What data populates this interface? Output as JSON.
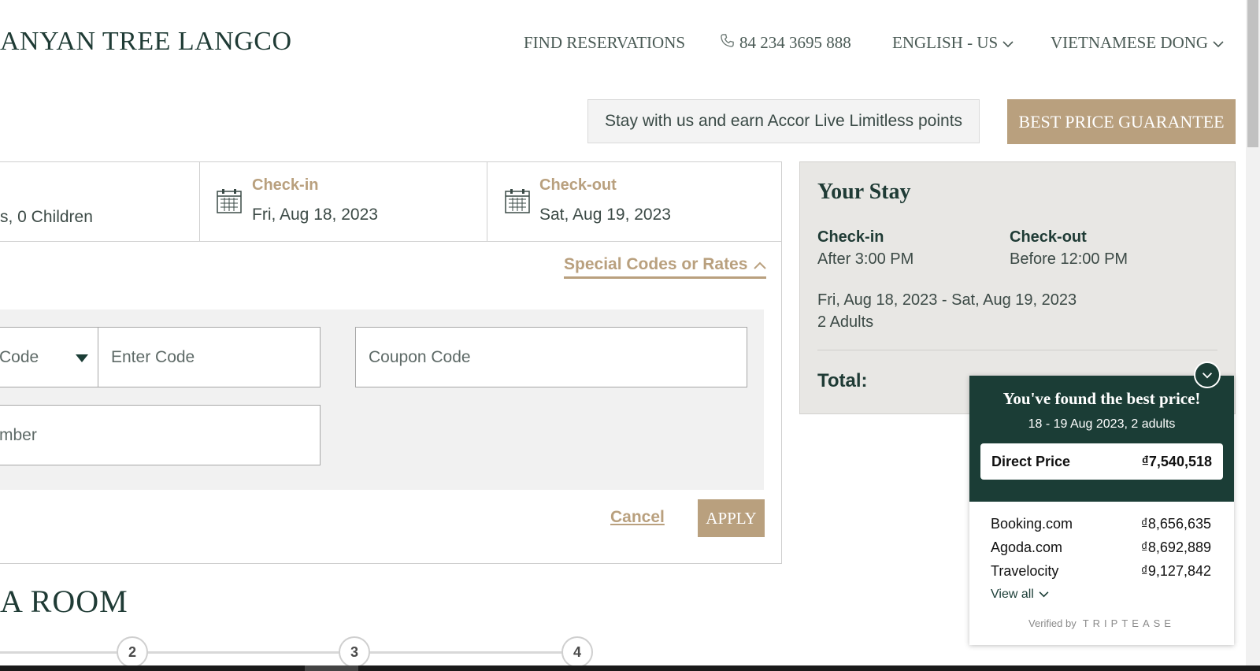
{
  "header": {
    "brand": "ANYAN TREE LANGCO",
    "nav": {
      "find_reservations": "FIND RESERVATIONS",
      "phone": "84 234 3695 888",
      "language": "ENGLISH - US",
      "currency": "VIETNAMESE DONG"
    }
  },
  "promo": {
    "accor_text": "Stay with us and earn Accor Live Limitless points",
    "best_price": "BEST PRICE GUARANTEE"
  },
  "booking": {
    "guests": "s, 0 Children",
    "checkin_label": "Check-in",
    "checkin_value": "Fri, Aug 18, 2023",
    "checkout_label": "Check-out",
    "checkout_value": "Sat, Aug 19, 2023",
    "special_codes": "Special Codes or Rates",
    "code_type": "Code",
    "enter_code_placeholder": "Enter Code",
    "coupon_placeholder": "Coupon Code",
    "member_placeholder": "mber",
    "cancel": "Cancel",
    "apply": "APPLY"
  },
  "section_title": "A ROOM",
  "steps": [
    "2",
    "3",
    "4"
  ],
  "your_stay": {
    "title": "Your Stay",
    "checkin_label": "Check-in",
    "checkin_value": "After 3:00 PM",
    "checkout_label": "Check-out",
    "checkout_value": "Before 12:00 PM",
    "dates": "Fri, Aug 18, 2023 - Sat, Aug 19, 2023",
    "guests": "2 Adults",
    "total_label": "Total:"
  },
  "triptease": {
    "title": "You've found the best price!",
    "subtitle": "18 - 19 Aug 2023, 2 adults",
    "direct_label": "Direct Price",
    "direct_price": "₫7,540,518",
    "competitors": [
      {
        "name": "Booking.com",
        "price": "₫8,656,635"
      },
      {
        "name": "Agoda.com",
        "price": "₫8,692,889"
      },
      {
        "name": "Travelocity",
        "price": "₫9,127,842"
      }
    ],
    "view_all": "View all",
    "verified_by": "Verified by",
    "verified_brand": "TRIPTEASE"
  },
  "colors": {
    "accent_gold": "#b9a07e",
    "dark_green": "#1b3d36",
    "text_green": "#1f3b35"
  }
}
